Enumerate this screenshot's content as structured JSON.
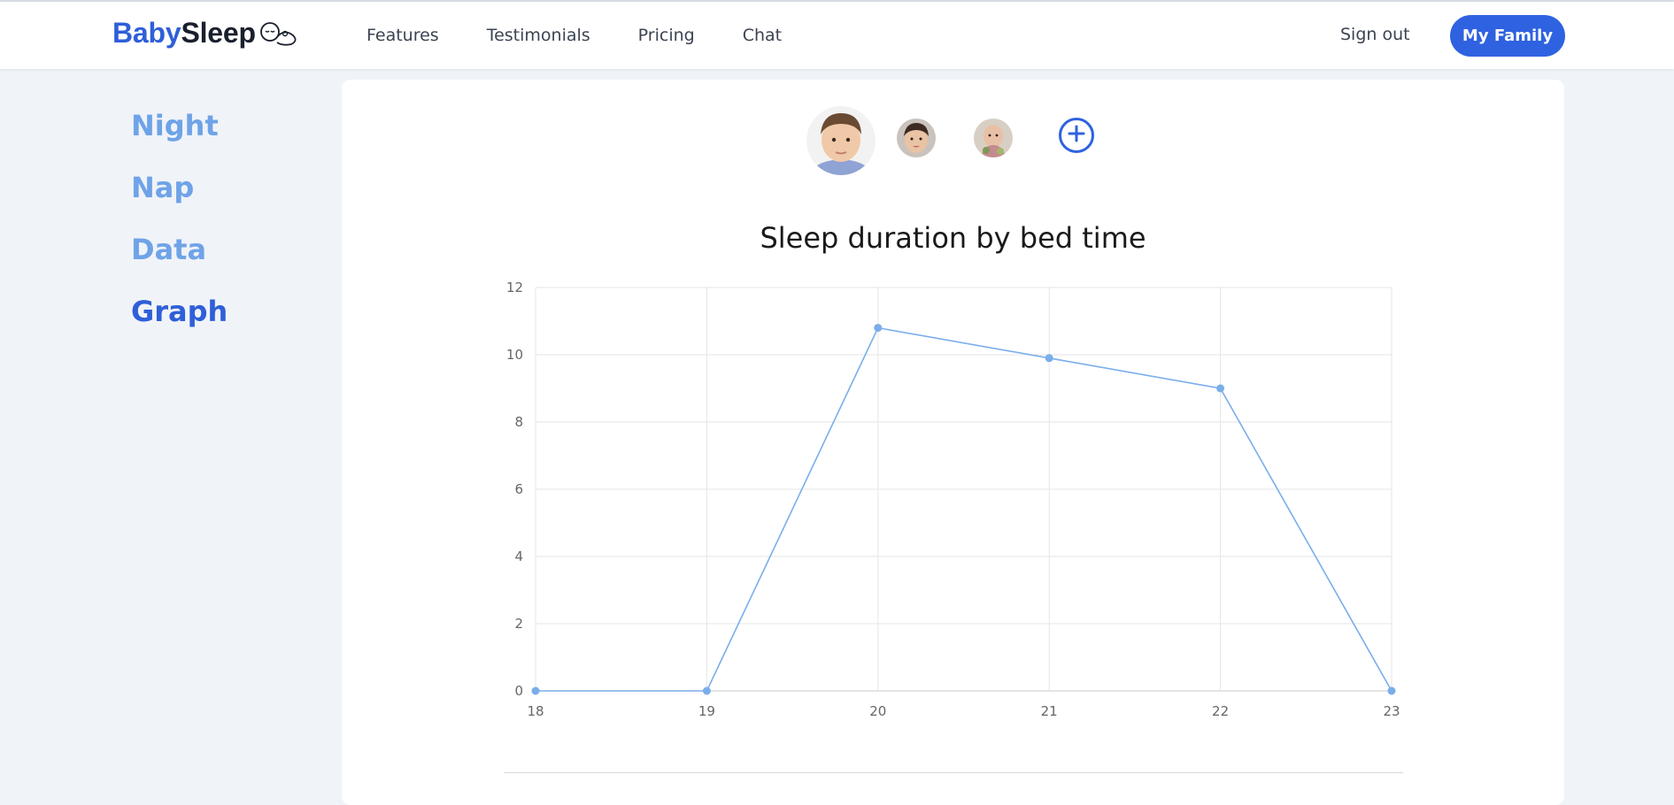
{
  "header": {
    "brand_part1": "Baby",
    "brand_part2": "Sleep",
    "nav": [
      "Features",
      "Testimonials",
      "Pricing",
      "Chat"
    ],
    "signout_label": "Sign out",
    "family_label": "My Family"
  },
  "sidebar": {
    "items": [
      {
        "label": "Night",
        "active": false
      },
      {
        "label": "Nap",
        "active": false
      },
      {
        "label": "Data",
        "active": false
      },
      {
        "label": "Graph",
        "active": true
      }
    ]
  },
  "children": [
    {
      "icon": "baby-photo-1",
      "selected": true
    },
    {
      "icon": "baby-photo-2",
      "selected": false
    },
    {
      "icon": "baby-photo-3",
      "selected": false
    }
  ],
  "add_child_icon": "plus-circle-icon",
  "colors": {
    "accent": "#2f62e0",
    "sidebar_inactive": "#6fa3e8",
    "line": "#7aaeea"
  },
  "chart_data": {
    "type": "line",
    "title": "Sleep duration by bed time",
    "xlabel": "",
    "ylabel": "",
    "x": [
      18,
      19,
      20,
      21,
      22,
      23
    ],
    "series": [
      {
        "values": [
          0,
          0,
          10.8,
          9.9,
          9.0,
          0
        ]
      }
    ],
    "xlim": [
      18,
      23
    ],
    "ylim": [
      0,
      12
    ],
    "y_ticks": [
      0,
      2,
      4,
      6,
      8,
      10,
      12
    ],
    "x_ticks": [
      18,
      19,
      20,
      21,
      22,
      23
    ],
    "grid": true
  }
}
